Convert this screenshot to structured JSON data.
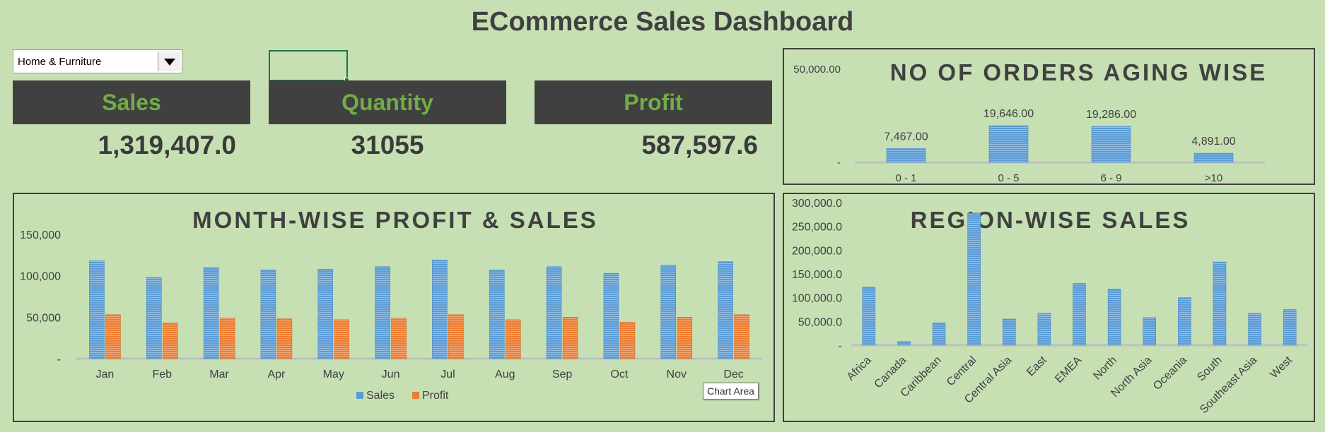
{
  "title": "ECommerce Sales Dashboard",
  "filter": {
    "selected": "Home & Furniture"
  },
  "kpis": {
    "sales_label": "Sales",
    "sales_value": "1,319,407.0",
    "quantity_label": "Quantity",
    "quantity_value": "31055",
    "profit_label": "Profit",
    "profit_value": "587,597.6"
  },
  "tooltip": "Chart Area",
  "colors": {
    "background": "#c6e0b4",
    "dark": "#404040",
    "accent": "#70ad47",
    "sales": "#5b9bd5",
    "profit": "#ed7d31"
  },
  "chart_data": [
    {
      "id": "aging",
      "type": "bar",
      "title": "NO OF ORDERS AGING WISE",
      "categories": [
        "0 - 1",
        "0 - 5",
        "6 - 9",
        ">10"
      ],
      "values": [
        7467,
        19646,
        19286,
        4891
      ],
      "data_labels": [
        "7,467.00",
        "19,646.00",
        "19,286.00",
        "4,891.00"
      ],
      "ylim": [
        0,
        50000
      ],
      "yticks": [
        0,
        50000
      ],
      "ytick_labels": [
        "-",
        "50,000.00"
      ]
    },
    {
      "id": "monthly",
      "type": "bar",
      "title": "MONTH-WISE PROFIT & SALES",
      "categories": [
        "Jan",
        "Feb",
        "Mar",
        "Apr",
        "May",
        "Jun",
        "Jul",
        "Aug",
        "Sep",
        "Oct",
        "Nov",
        "Dec"
      ],
      "series": [
        {
          "name": "Sales",
          "values": [
            118000,
            98000,
            110000,
            107000,
            108000,
            111000,
            119000,
            107000,
            111000,
            103000,
            113000,
            117000
          ]
        },
        {
          "name": "Profit",
          "values": [
            53000,
            43000,
            49000,
            48000,
            47000,
            49000,
            53000,
            47000,
            50000,
            44000,
            50000,
            53000
          ]
        }
      ],
      "ylim": [
        0,
        150000
      ],
      "yticks": [
        0,
        50000,
        100000,
        150000
      ],
      "ytick_labels": [
        "-",
        "50,000",
        "100,000",
        "150,000"
      ],
      "legend": "bottom"
    },
    {
      "id": "region",
      "type": "bar",
      "title": "REGION-WISE SALES",
      "categories": [
        "Africa",
        "Canada",
        "Caribbean",
        "Central",
        "Central Asia",
        "East",
        "EMEA",
        "North",
        "North Asia",
        "Oceania",
        "South",
        "Southeast Asia",
        "West"
      ],
      "values": [
        122000,
        8000,
        47000,
        278000,
        55000,
        67000,
        130000,
        118000,
        58000,
        100000,
        175000,
        67000,
        75000
      ],
      "ylim": [
        0,
        300000
      ],
      "yticks": [
        0,
        50000,
        100000,
        150000,
        200000,
        250000,
        300000
      ],
      "ytick_labels": [
        "-",
        "50,000.0",
        "100,000.0",
        "150,000.0",
        "200,000.0",
        "250,000.0",
        "300,000.0"
      ]
    }
  ]
}
